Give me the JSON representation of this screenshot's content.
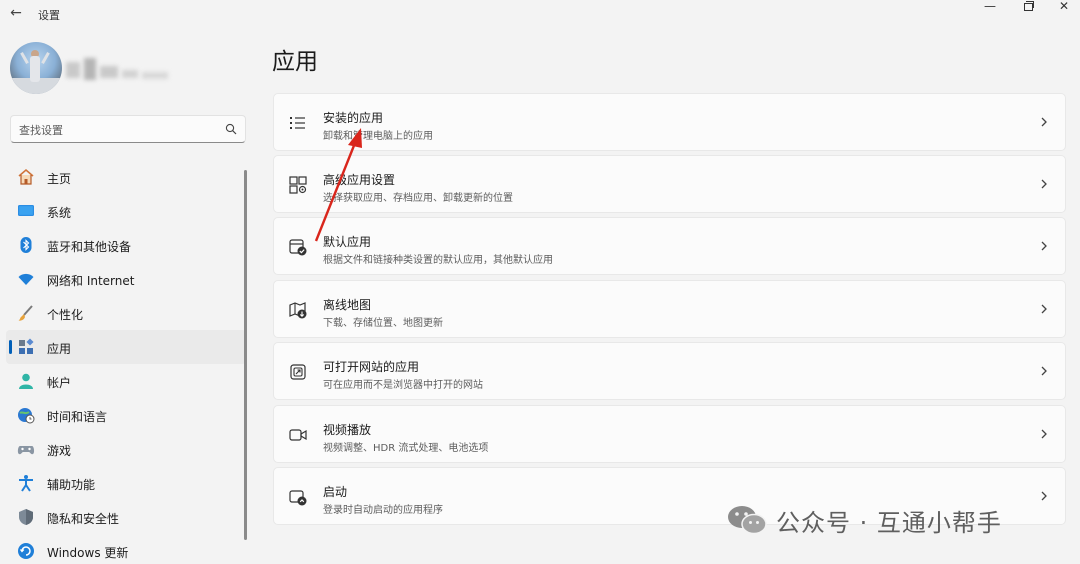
{
  "window": {
    "title": "设置",
    "back_glyph": "←",
    "minimize_glyph": "—",
    "close_glyph": "✕"
  },
  "search": {
    "placeholder": "查找设置"
  },
  "sidebar": {
    "items": [
      {
        "label": "主页",
        "icon": "home-icon"
      },
      {
        "label": "系统",
        "icon": "system-icon"
      },
      {
        "label": "蓝牙和其他设备",
        "icon": "bluetooth-icon"
      },
      {
        "label": "网络和 Internet",
        "icon": "wifi-icon"
      },
      {
        "label": "个性化",
        "icon": "brush-icon"
      },
      {
        "label": "应用",
        "icon": "apps-icon",
        "selected": true
      },
      {
        "label": "帐户",
        "icon": "account-icon"
      },
      {
        "label": "时间和语言",
        "icon": "globe-clock-icon"
      },
      {
        "label": "游戏",
        "icon": "gamepad-icon"
      },
      {
        "label": "辅助功能",
        "icon": "accessibility-icon"
      },
      {
        "label": "隐私和安全性",
        "icon": "shield-icon"
      },
      {
        "label": "Windows 更新",
        "icon": "update-icon"
      }
    ]
  },
  "main": {
    "title": "应用",
    "cards": [
      {
        "title": "安装的应用",
        "desc": "卸载和管理电脑上的应用",
        "icon": "installed-apps-icon"
      },
      {
        "title": "高级应用设置",
        "desc": "选择获取应用、存档应用、卸载更新的位置",
        "icon": "advanced-apps-icon"
      },
      {
        "title": "默认应用",
        "desc": "根据文件和链接种类设置的默认应用，其他默认应用",
        "icon": "default-apps-icon"
      },
      {
        "title": "离线地图",
        "desc": "下载、存储位置、地图更新",
        "icon": "offline-maps-icon"
      },
      {
        "title": "可打开网站的应用",
        "desc": "可在应用而不是浏览器中打开的网站",
        "icon": "apps-for-websites-icon"
      },
      {
        "title": "视频播放",
        "desc": "视频调整、HDR 流式处理、电池选项",
        "icon": "video-playback-icon"
      },
      {
        "title": "启动",
        "desc": "登录时自动启动的应用程序",
        "icon": "startup-icon"
      }
    ]
  },
  "watermark": {
    "text": "公众号 · 互通小帮手"
  },
  "colors": {
    "accent": "#005fb8",
    "annotation_arrow": "#d9261c"
  }
}
